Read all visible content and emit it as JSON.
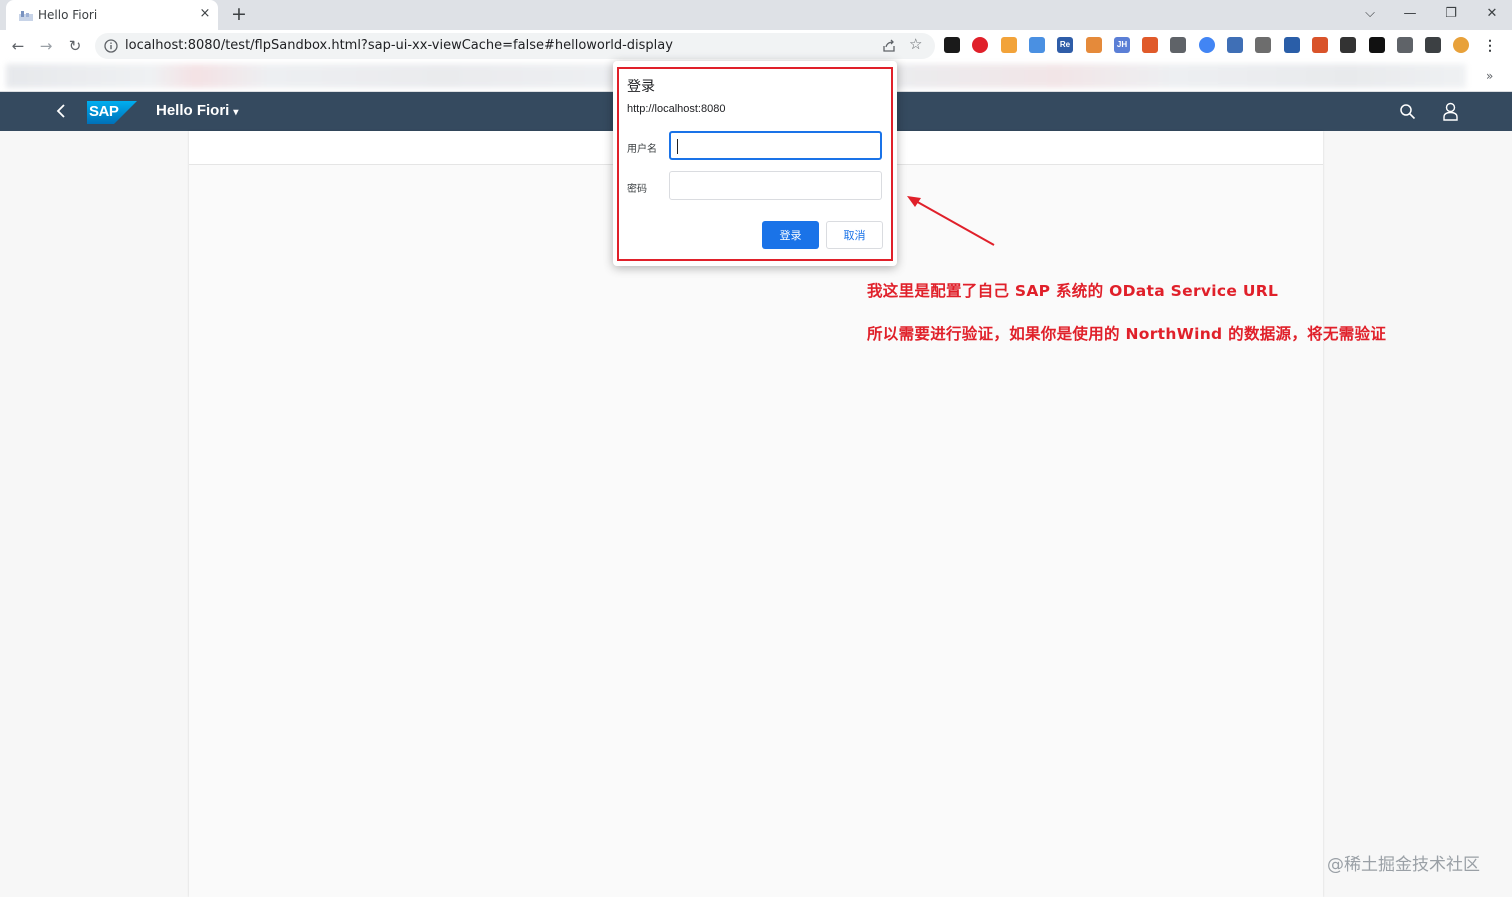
{
  "browser": {
    "tab_title": "Hello Fiori",
    "tab_close": "×",
    "new_tab": "+",
    "url": "localhost:8080/test/flpSandbox.html?sap-ui-xx-viewCache=false#helloworld-display",
    "window_controls": {
      "tab_search": "⌵",
      "minimize": "—",
      "restore": "❐",
      "close": "✕"
    },
    "nav": {
      "back": "←",
      "forward": "→",
      "reload": "↻"
    },
    "star": "☆",
    "bookmarks_more": "»",
    "extensions": [
      {
        "name": "ext-1",
        "label": "",
        "color": "#1a1a1a"
      },
      {
        "name": "ext-2",
        "label": "",
        "color": "#e0202a"
      },
      {
        "name": "ext-3",
        "label": "",
        "color": "#f2a33a"
      },
      {
        "name": "ext-4",
        "label": "",
        "color": "#4a90e2"
      },
      {
        "name": "ext-5",
        "label": "Re",
        "color": "#2f5da8"
      },
      {
        "name": "ext-6",
        "label": "",
        "color": "#e58a3a"
      },
      {
        "name": "ext-7",
        "label": "JH",
        "color": "#5b7fd6"
      },
      {
        "name": "ext-8",
        "label": "",
        "color": "#e05a2a"
      },
      {
        "name": "ext-9",
        "label": "",
        "color": "#5f6368"
      },
      {
        "name": "ext-10",
        "label": "",
        "color": "#4285f4"
      },
      {
        "name": "ext-11",
        "label": "",
        "color": "#3f6fb6"
      },
      {
        "name": "ext-12",
        "label": "",
        "color": "#6d6d6d"
      },
      {
        "name": "ext-13",
        "label": "",
        "color": "#2a5ea8"
      },
      {
        "name": "ext-14",
        "label": "",
        "color": "#d9532a"
      },
      {
        "name": "ext-15",
        "label": "",
        "color": "#333333"
      },
      {
        "name": "ext-16",
        "label": "",
        "color": "#111111"
      },
      {
        "name": "extensions-puzzle",
        "label": "",
        "color": "#5f6368"
      },
      {
        "name": "side-panel",
        "label": "",
        "color": "#3c4043"
      },
      {
        "name": "profile-avatar",
        "label": "",
        "color": "#e8a13a"
      },
      {
        "name": "chrome-menu",
        "label": "⋮",
        "color": "#ffffff"
      }
    ]
  },
  "shell": {
    "title": "Hello Fiori",
    "caret": "▾",
    "logo_text": "SAP"
  },
  "dialog": {
    "title": "登录",
    "origin": "http://localhost:8080",
    "username_label": "用户名",
    "username_value": "",
    "password_label": "密码",
    "password_value": "",
    "login_button": "登录",
    "cancel_button": "取消"
  },
  "annotation": {
    "line1": "我这里是配置了自己 SAP 系统的 OData Service URL",
    "line2": "所以需要进行验证，如果你是使用的 NorthWind 的数据源，将无需验证",
    "color": "#e0202a"
  },
  "watermark": "@稀土掘金技术社区"
}
